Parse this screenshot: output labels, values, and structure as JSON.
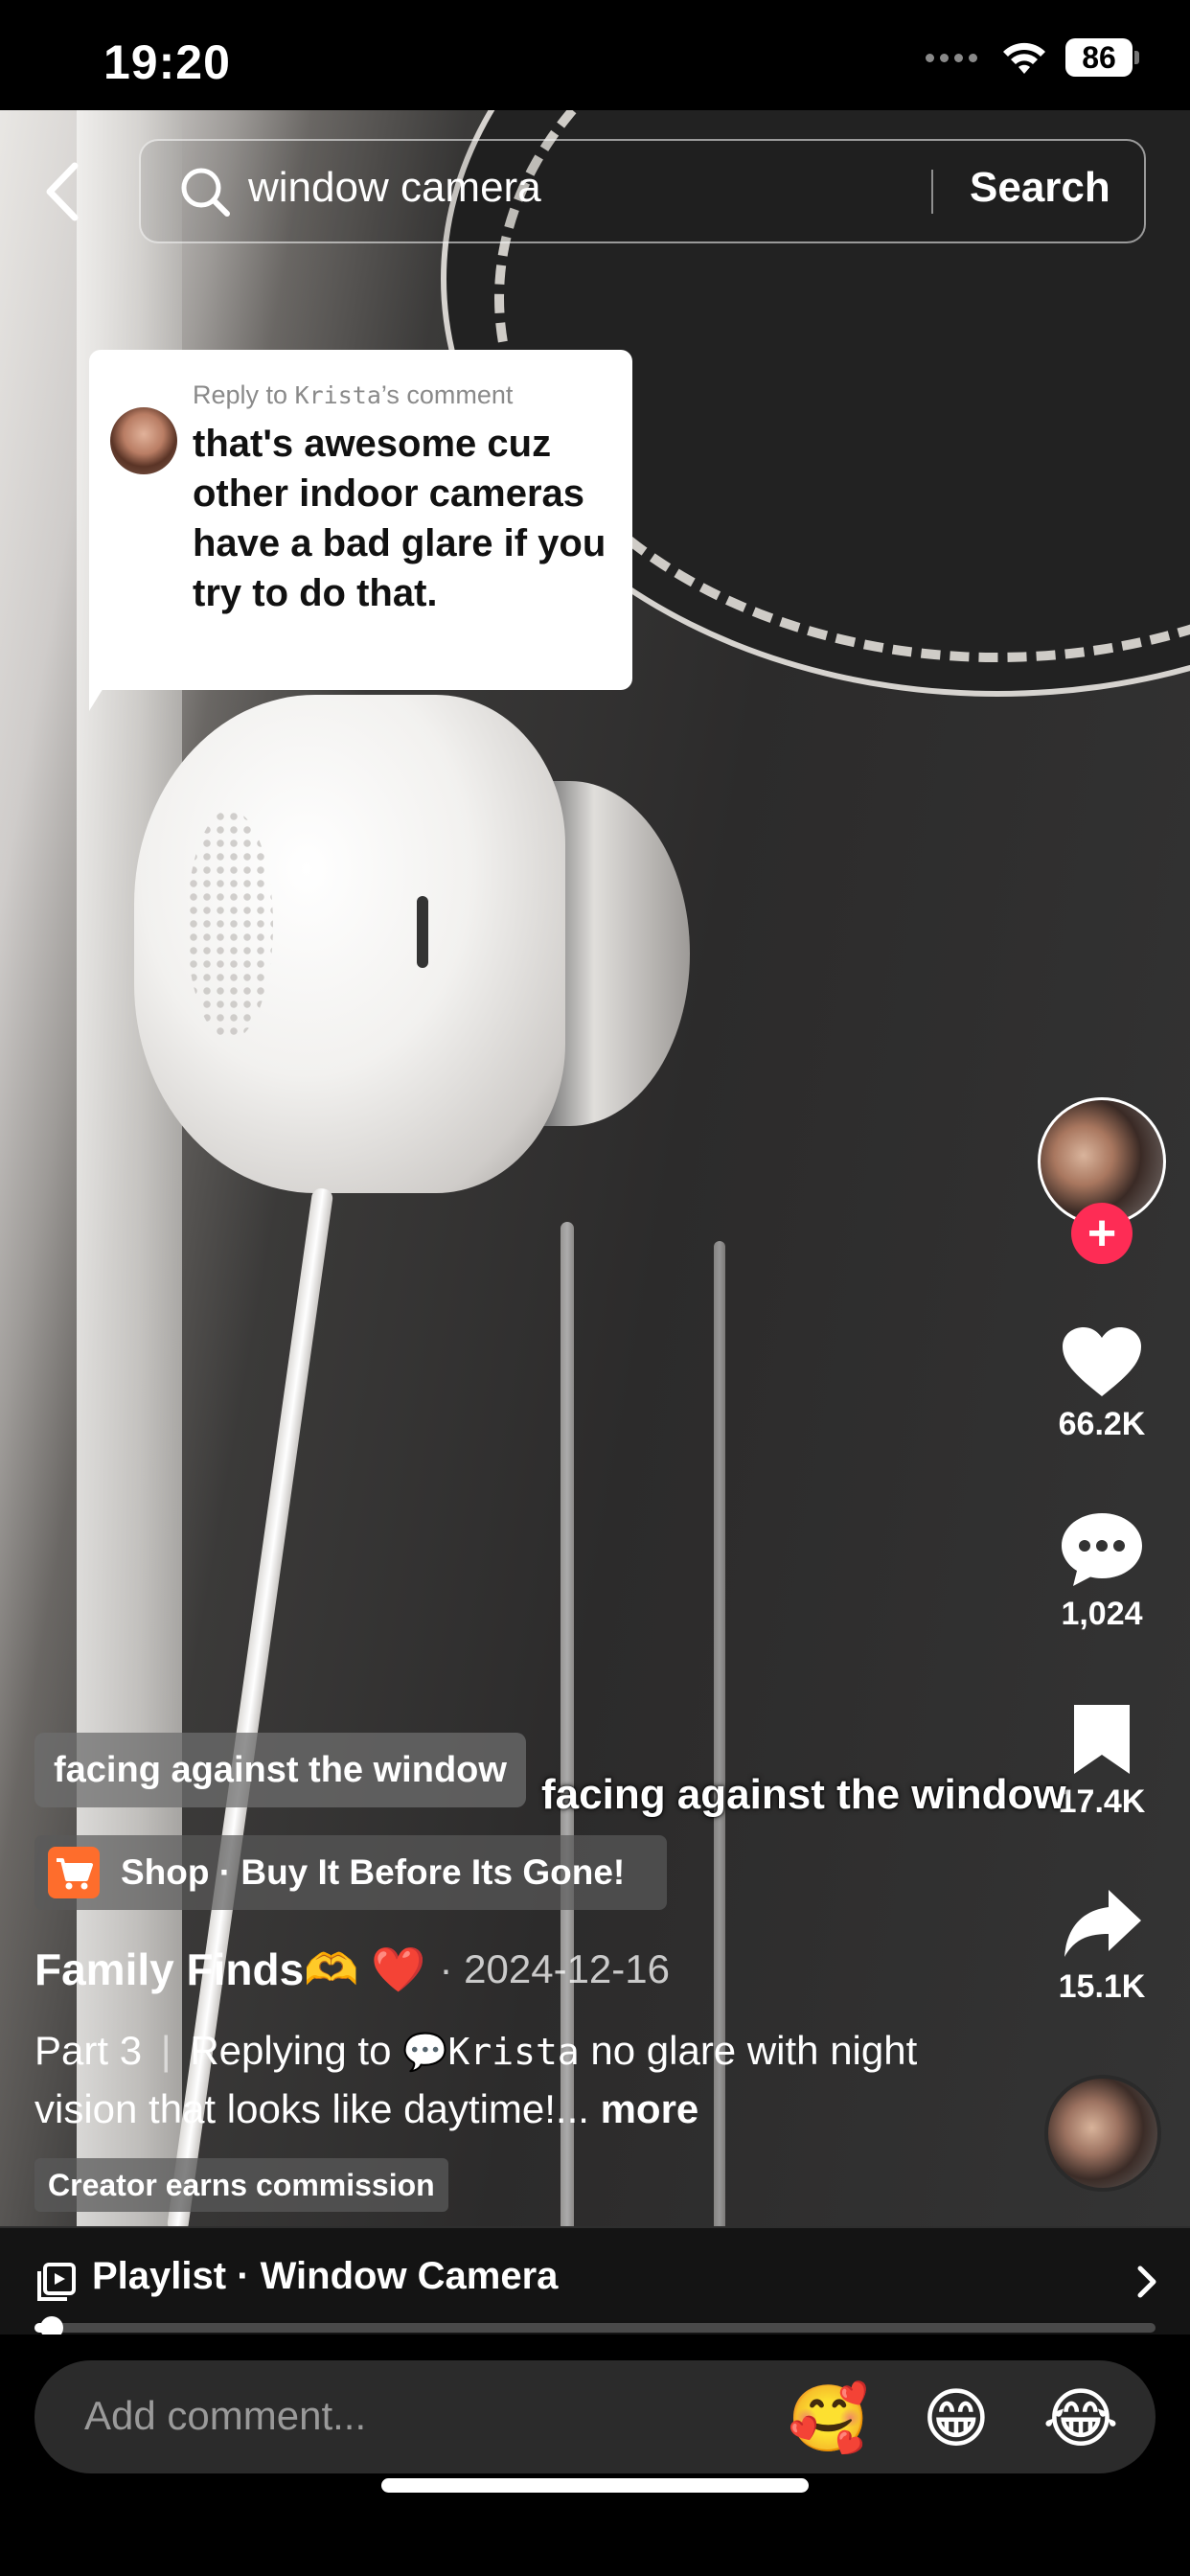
{
  "status_bar": {
    "time": "19:20",
    "battery": "86"
  },
  "search": {
    "query": "window camera",
    "button_label": "Search"
  },
  "reply_card": {
    "label_prefix": "Reply to ",
    "commenter": "Krista",
    "label_suffix": "’s comment",
    "text": "that's awesome cuz other indoor cameras have a bad glare if you try to do that."
  },
  "rail": {
    "likes": "66.2K",
    "comments": "1,024",
    "saves": "17.4K",
    "shares": "15.1K",
    "follow_symbol": "+"
  },
  "video": {
    "caption_chip": "facing against the window",
    "subtitle": "facing against the window",
    "shop_text": "Shop · Buy It Before Its Gone!",
    "author": "Family Finds🫶 ❤️",
    "date": "· 2024-12-16",
    "desc_part": "Part 3",
    "desc_separator": "|",
    "desc_replying": "Replying to",
    "desc_mention": "💬Krista",
    "desc_body": " no glare with night vision that looks like daytime!...",
    "desc_more": " more",
    "commission_badge": "Creator earns commission"
  },
  "playlist": {
    "label": "Playlist · Window Camera"
  },
  "playback": {
    "progress": 0.015
  },
  "comment": {
    "placeholder": "Add comment...",
    "emojis": [
      "🥰",
      "😁",
      "😂"
    ]
  },
  "icons": {
    "back": "chevron-left-icon",
    "search": "search-icon",
    "like": "heart-icon",
    "comment": "comment-bubble-icon",
    "save": "bookmark-icon",
    "share": "share-arrow-icon",
    "shop": "cart-icon",
    "playlist": "playlist-icon",
    "chevron": "chevron-right-icon"
  },
  "colors": {
    "follow_accent": "#fe2c55",
    "shop_accent": "#fe6d2c"
  }
}
